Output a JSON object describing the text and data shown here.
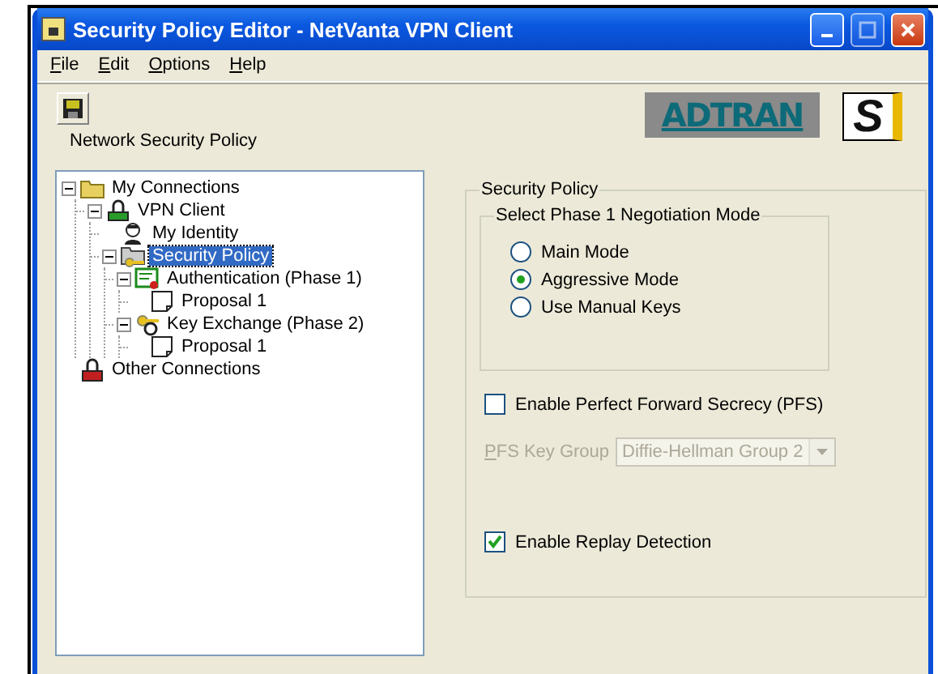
{
  "window": {
    "title": "Security Policy Editor - NetVanta VPN Client"
  },
  "menu": [
    "File",
    "Edit",
    "Options",
    "Help"
  ],
  "logos": [
    {
      "text": "ADTRAN"
    },
    {
      "text": "S"
    }
  ],
  "tree_label": "Network Security Policy",
  "tree": [
    {
      "label": "My Connections",
      "kind": "folder",
      "selected": false,
      "expanded": true,
      "children": [
        {
          "label": "VPN Client",
          "kind": "lock",
          "selected": false,
          "expanded": true,
          "children": [
            {
              "label": "My Identity",
              "kind": "person",
              "selected": false
            },
            {
              "label": "Security Policy",
              "kind": "folder-key",
              "selected": true,
              "expanded": true,
              "children": [
                {
                  "label": "Authentication (Phase 1)",
                  "kind": "certificate",
                  "selected": false,
                  "expanded": true,
                  "children": [
                    {
                      "label": "Proposal 1",
                      "kind": "document",
                      "selected": false
                    }
                  ]
                },
                {
                  "label": "Key Exchange (Phase 2)",
                  "kind": "keys",
                  "selected": false,
                  "expanded": true,
                  "children": [
                    {
                      "label": "Proposal 1",
                      "kind": "document",
                      "selected": false
                    }
                  ]
                }
              ]
            }
          ]
        }
      ]
    },
    {
      "label": "Other Connections",
      "kind": "lock-stack",
      "selected": false
    }
  ],
  "security_policy": {
    "title": "Security Policy",
    "negotiation": {
      "title": "Select Phase 1 Negotiation Mode",
      "options": [
        {
          "label": "Main Mode",
          "selected": false
        },
        {
          "label": "Aggressive Mode",
          "selected": true
        },
        {
          "label": "Use Manual Keys",
          "selected": false
        }
      ]
    },
    "pfs": {
      "label": "Enable Perfect Forward Secrecy (PFS)",
      "checked": false
    },
    "pfs_key_group": {
      "label": "PFS Key Group",
      "value": "Diffie-Hellman Group 2",
      "disabled": true
    },
    "replay": {
      "label": "Enable Replay Detection",
      "checked": true
    }
  }
}
